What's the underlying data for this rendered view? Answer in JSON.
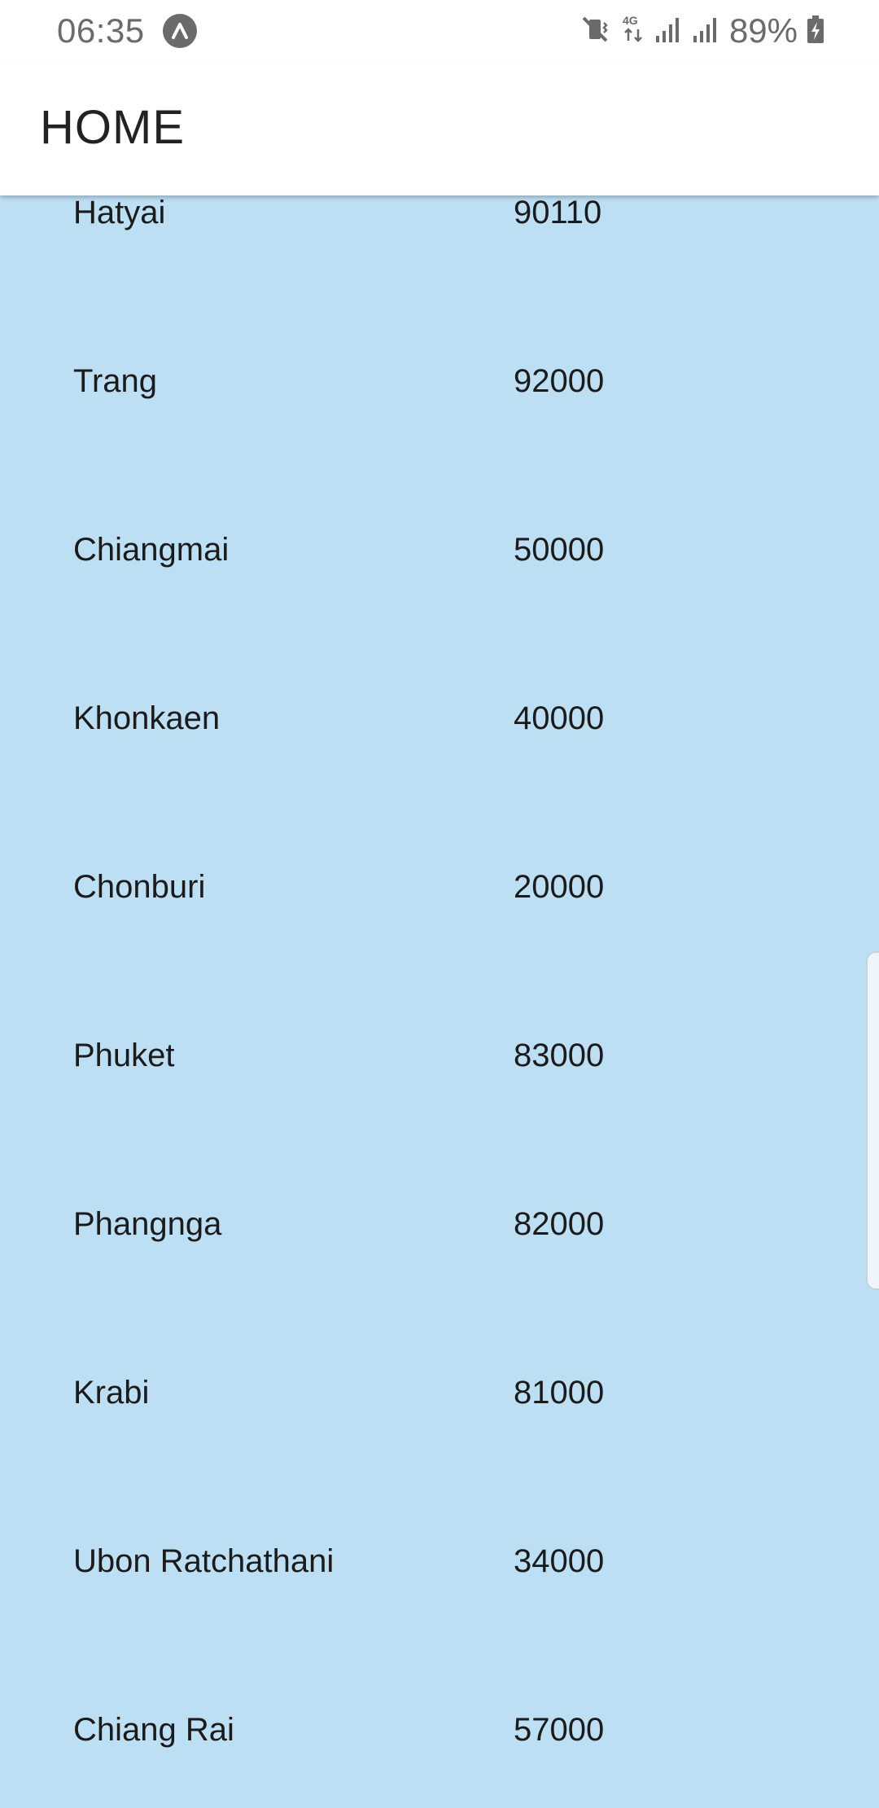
{
  "status_bar": {
    "time": "06:35",
    "battery": "89%",
    "icons": [
      "app-notification-icon",
      "mute-vibrate-icon",
      "network-4g-icon",
      "signal-icon",
      "signal-icon",
      "battery-charging-icon"
    ]
  },
  "app_bar": {
    "title": "HOME"
  },
  "list": {
    "items": [
      {
        "city": "Hatyai",
        "postcode": "90110"
      },
      {
        "city": "Trang",
        "postcode": "92000"
      },
      {
        "city": "Chiangmai",
        "postcode": "50000"
      },
      {
        "city": "Khonkaen",
        "postcode": "40000"
      },
      {
        "city": "Chonburi",
        "postcode": "20000"
      },
      {
        "city": "Phuket",
        "postcode": "83000"
      },
      {
        "city": "Phangnga",
        "postcode": "82000"
      },
      {
        "city": "Krabi",
        "postcode": "81000"
      },
      {
        "city": "Ubon Ratchathani",
        "postcode": "34000"
      },
      {
        "city": "Chiang Rai",
        "postcode": "57000"
      }
    ]
  },
  "colors": {
    "list_background": "#bddff4",
    "app_bar_background": "#ffffff",
    "text": "#1b1b1b"
  }
}
